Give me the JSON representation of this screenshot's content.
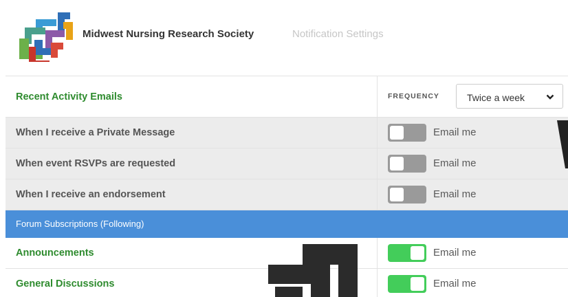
{
  "header": {
    "org_name": "Midwest Nursing Research Society",
    "page_title": "Notification Settings"
  },
  "activity": {
    "title": "Recent Activity Emails",
    "frequency_label": "FREQUENCY",
    "frequency_value": "Twice a week",
    "items": [
      {
        "label": "When I receive a Private Message",
        "toggle_text": "Email me",
        "enabled": false
      },
      {
        "label": "When event RSVPs are requested",
        "toggle_text": "Email me",
        "enabled": false
      },
      {
        "label": "When I receive an endorsement",
        "toggle_text": "Email me",
        "enabled": false
      }
    ]
  },
  "forum": {
    "section_title": "Forum Subscriptions (Following)",
    "items": [
      {
        "label": "Announcements",
        "toggle_text": "Email me",
        "enabled": true
      },
      {
        "label": "General Discussions",
        "toggle_text": "Email me",
        "enabled": true
      }
    ]
  },
  "colors": {
    "accent_green": "#2e8b2e",
    "toggle_on": "#43cd5a",
    "toggle_off": "#9a9a9a",
    "section_blue": "#4a8fd9"
  },
  "icons": {
    "logo": "msrs-logo-icon",
    "dropdown": "chevron-down-icon"
  }
}
